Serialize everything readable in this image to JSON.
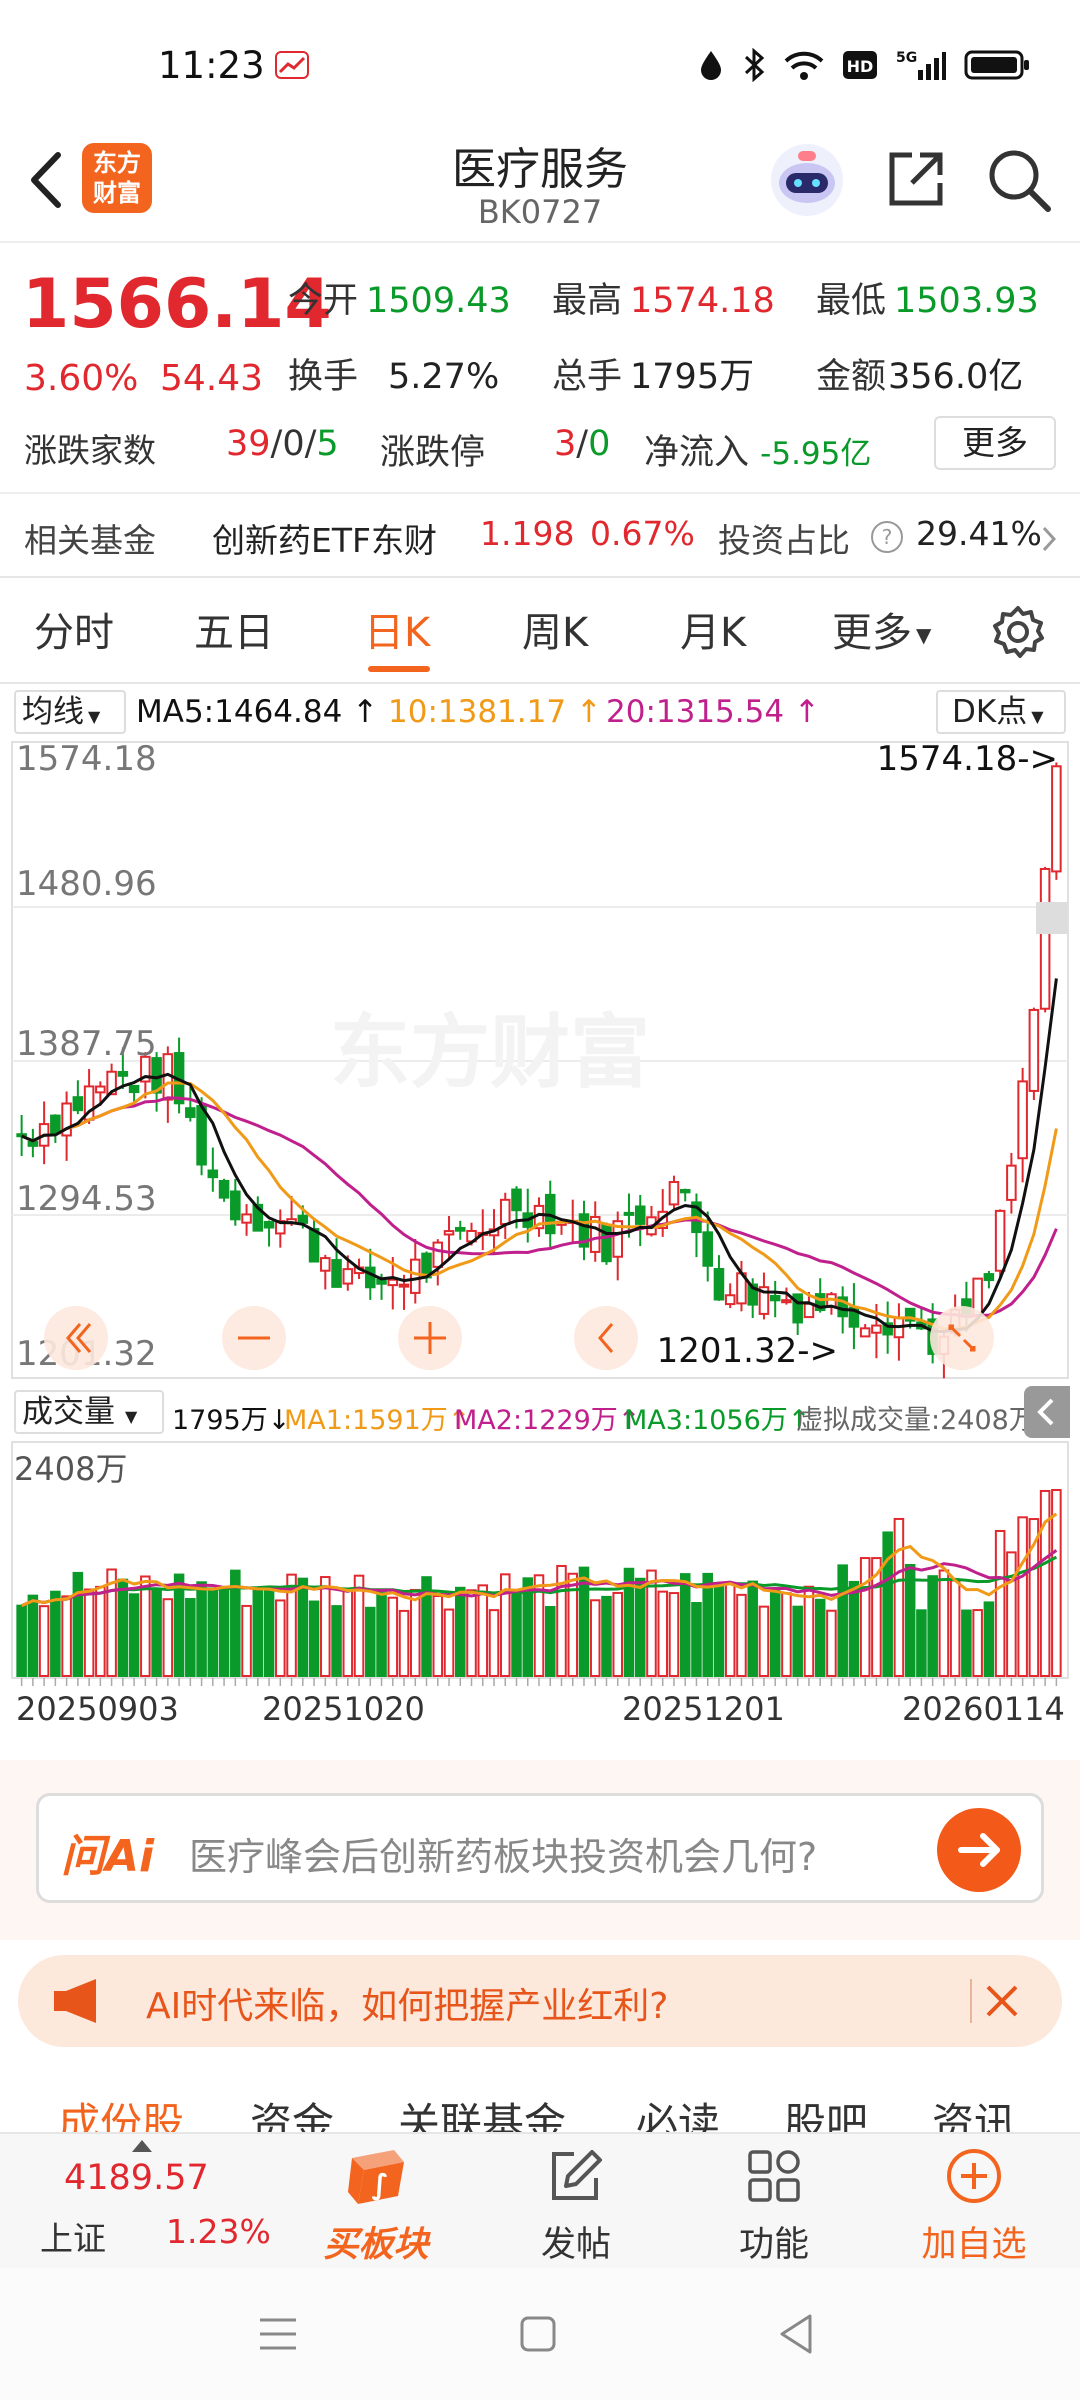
{
  "status_bar": {
    "time": "11:23"
  },
  "header": {
    "title": "医疗服务",
    "code": "BK0727",
    "logo_text": "东方\n财富"
  },
  "quote": {
    "price": "1566.14",
    "change_pct": "3.60%",
    "change": "54.43",
    "open_label": "今开",
    "open": "1509.43",
    "high_label": "最高",
    "high": "1574.18",
    "low_label": "最低",
    "low": "1503.93",
    "turnover_label": "换手",
    "turnover": "5.27%",
    "volume_label": "总手",
    "volume": "1795万",
    "amount_label": "金额",
    "amount": "356.0亿",
    "advdec_label": "涨跌家数",
    "adv": "39",
    "flat": "0",
    "dec": "5",
    "limit_label": "涨跌停",
    "limit_up": "3",
    "limit_down": "0",
    "netflow_label": "净流入",
    "netflow": "-5.95亿",
    "more": "更多"
  },
  "fund": {
    "label": "相关基金",
    "name": "创新药ETF东财",
    "price": "1.198",
    "pct": "0.67%",
    "ratio_label": "投资占比",
    "ratio": "29.41%"
  },
  "tabs": [
    {
      "label": "分时"
    },
    {
      "label": "五日"
    },
    {
      "label": "日K"
    },
    {
      "label": "周K"
    },
    {
      "label": "月K"
    },
    {
      "label": "更多"
    }
  ],
  "ma_legend": {
    "select": "均线",
    "ma5": "MA5:1464.84",
    "ma10": "10:1381.17",
    "ma20": "20:1315.54",
    "dk": "DK点"
  },
  "kline": {
    "y_labels": [
      "1574.18",
      "1480.96",
      "1387.75",
      "1294.53",
      "1201.32"
    ],
    "max_marker": "1574.18->",
    "min_marker": "1201.32->",
    "watermark": "东方财富"
  },
  "volume": {
    "select": "成交量",
    "vol": "1795万",
    "ma1": "MA1:1591万",
    "ma2": "MA2:1229万",
    "ma3": "MA3:1056万",
    "virtual": "虚拟成交量:2408万",
    "max_label": "2408万"
  },
  "dates": [
    "20250903",
    "20251020",
    "20251201",
    "20260114"
  ],
  "ask_ai": {
    "logo": "问Ai",
    "placeholder": "医疗峰会后创新药板块投资机会几何?"
  },
  "banner": {
    "text": "AI时代来临，如何把握产业红利?"
  },
  "subtabs": [
    {
      "label": "成份股"
    },
    {
      "label": "资金"
    },
    {
      "label": "关联基金"
    },
    {
      "label": "必读"
    },
    {
      "label": "股吧"
    },
    {
      "label": "资讯"
    }
  ],
  "bottom_bar": {
    "index_value": "4189.57",
    "index_name": "上证",
    "index_pct": "1.23%",
    "buy_label": "买板块",
    "post_label": "发帖",
    "func_label": "功能",
    "add_label": "加自选"
  },
  "colors": {
    "accent": "#f3651f",
    "up": "#e0282e",
    "down": "#0a9a2a",
    "ma5": "#111111",
    "ma10": "#f09a18",
    "ma20": "#c0208c"
  }
}
